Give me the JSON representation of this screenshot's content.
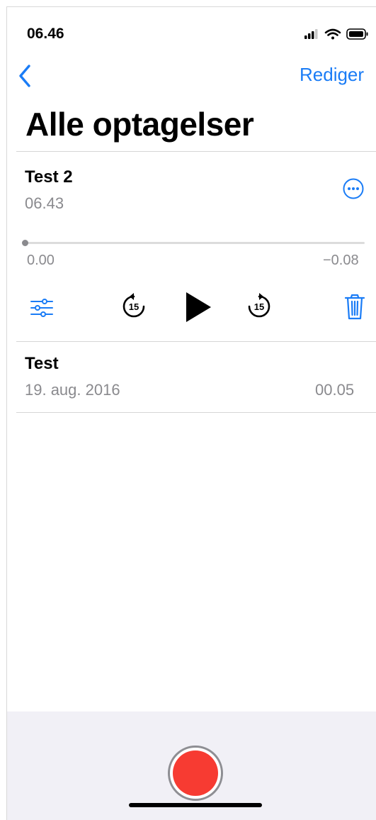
{
  "status": {
    "time": "06.46",
    "icons": [
      "signal-icon",
      "wifi-icon",
      "battery-icon"
    ]
  },
  "nav": {
    "back_icon": "chevron-left-icon",
    "edit_label": "Rediger"
  },
  "page": {
    "title": "Alle optagelser"
  },
  "expanded": {
    "name": "Test 2",
    "subtitle": "06.43",
    "progress": 0.0,
    "elapsed": "0.00",
    "remaining": "−0.08",
    "controls": [
      "options-icon",
      "skip-back-15-icon",
      "play-icon",
      "skip-forward-15-icon",
      "trash-icon"
    ],
    "skip_label": "15"
  },
  "recordings": [
    {
      "name": "Test",
      "date": "19. aug. 2016",
      "duration": "00.05"
    }
  ],
  "colors": {
    "accent": "#1a7cf6",
    "record": "#f73b32",
    "secondary_text": "#8a8a8e",
    "bottom_bar": "#f1f0f6"
  }
}
